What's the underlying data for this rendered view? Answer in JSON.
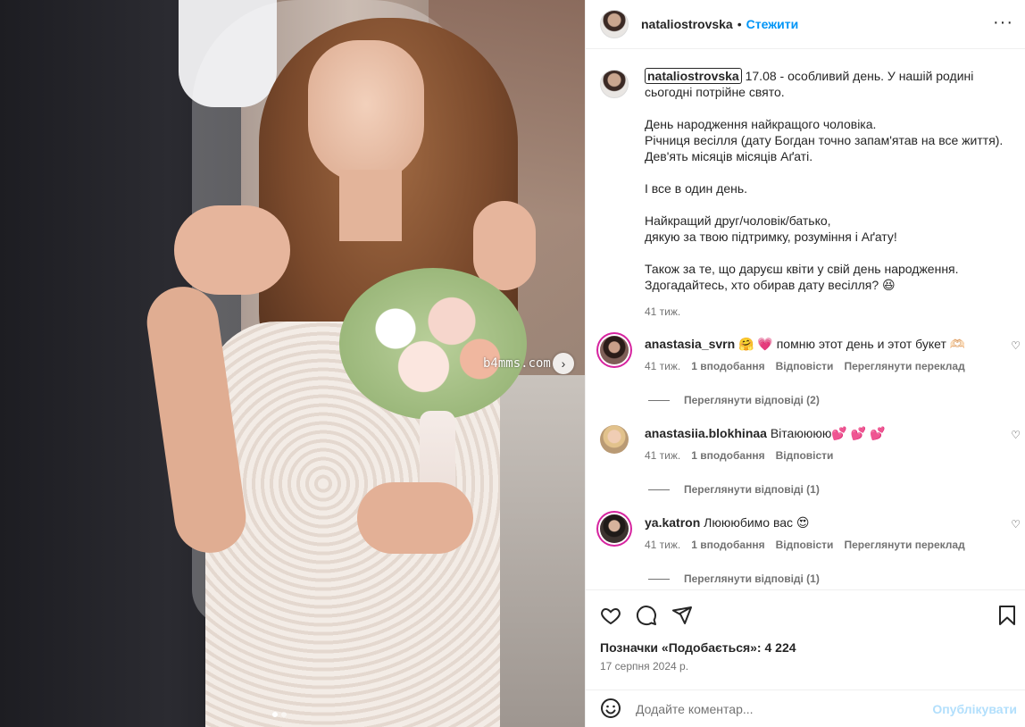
{
  "photo": {
    "watermark": "b4mms.com",
    "next_icon": "chevron-right-icon",
    "carousel_count": 2,
    "carousel_active": 1
  },
  "header": {
    "username": "nataliostrovska",
    "separator": "•",
    "follow_label": "Стежити",
    "more_icon": "more-horizontal-icon"
  },
  "caption": {
    "username": "nataliostrovska",
    "paragraphs": [
      "17.08 - особливий день. У нашій родині сьогодні потрійне свято.",
      "День народження найкращого чоловіка.\nРічниця весілля (дату Богдан точно запам'ятав на все життя).\nДев'ять місяців місяців Аґаті.",
      "І все в один день.",
      "Найкращий друг/чоловік/батько,\nдякую за твою підтримку, розуміння і Аґату!",
      "Також за те, що даруєш квіти у свій день народження.\nЗдогадайтесь, хто обирав дату весілля? 😆"
    ],
    "time": "41 тиж."
  },
  "comments": [
    {
      "username": "anastasia_svrn",
      "text": "🤗 💗 помню этот день и этот букет 🫶🏻",
      "time": "41 тиж.",
      "likes": "1 вподобання",
      "reply": "Відповісти",
      "translate": "Переглянути переклад",
      "view_replies": "Переглянути відповіді (2)"
    },
    {
      "username": "anastasiia.blokhinaa",
      "text": "Вітаюююю💕 💕 💕",
      "time": "41 тиж.",
      "likes": "1 вподобання",
      "reply": "Відповісти",
      "translate": "",
      "view_replies": "Переглянути відповіді (1)"
    },
    {
      "username": "ya.katron",
      "text": "Люююбимо вас 😍",
      "time": "41 тиж.",
      "likes": "1 вподобання",
      "reply": "Відповісти",
      "translate": "Переглянути переклад",
      "view_replies": "Переглянути відповіді (1)"
    }
  ],
  "actions": {
    "likes": "Позначки «Подобається»: 4 224",
    "date": "17 серпня 2024 р.",
    "comment_placeholder": "Додайте коментар...",
    "post_label": "Опублікувати"
  },
  "colors": {
    "accent": "#0095f6",
    "post_disabled": "#b2dffc",
    "muted": "#737373",
    "text": "#262626"
  }
}
